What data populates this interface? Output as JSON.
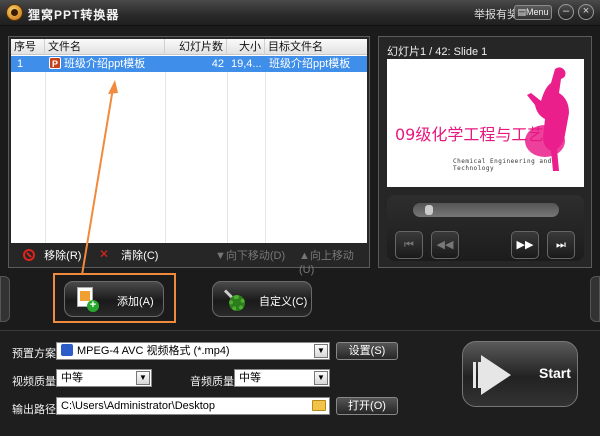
{
  "window": {
    "title": "狸窝PPT转换器",
    "report_link": "举报有奖",
    "menu_label": "Menu",
    "minimize": "–",
    "close": "×"
  },
  "file_list": {
    "columns": [
      "序号",
      "文件名",
      "幻灯片数",
      "大小",
      "目标文件名"
    ],
    "rows": [
      {
        "index": "1",
        "filename": "班级介绍ppt模板",
        "slides": "42",
        "size": "19,4...",
        "target": "班级介绍ppt模板"
      }
    ]
  },
  "list_actions": {
    "remove": "移除(R)",
    "clear": "清除(C)",
    "move_down": "向下移动(D)",
    "move_up": "向上移动(U)"
  },
  "preview": {
    "slide_label": "幻灯片1 / 42: Slide 1",
    "slide_title": "09级化学工程与工艺",
    "slide_subtitle": "Chemical Engineering and Technology",
    "seek_progress": 0.08
  },
  "buttons": {
    "add": "添加(A)",
    "customize": "自定义(C)"
  },
  "settings": {
    "preset_label": "预置方案:",
    "preset_value": "MPEG-4 AVC 视频格式 (*.mp4)",
    "preset_button": "设置(S)",
    "video_quality_label": "视频质量:",
    "video_quality_value": "中等",
    "audio_quality_label": "音频质量:",
    "audio_quality_value": "中等",
    "output_label": "输出路径:",
    "output_path": "C:\\Users\\Administrator\\Desktop",
    "open_button": "打开(O)",
    "start_button": "Start"
  },
  "colors": {
    "highlight_box": "#f08a3c",
    "selected_row": "#3f8ee9",
    "slide_title": "#e8177f"
  }
}
